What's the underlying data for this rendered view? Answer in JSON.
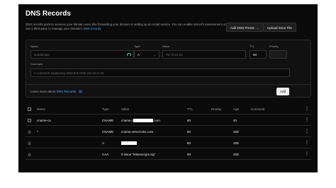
{
  "header": {
    "title": "DNS Records",
    "description_text": "DNS records point to services your domain uses, like forwarding your domain or setting up an email service. You can enable Vercel's nameservers or use a third-party to manage your domain's ",
    "description_link": "DNS records",
    "description_end": "."
  },
  "toolbar": {
    "add_preset_label": "Add DNS Preset",
    "upload_zone_label": "Upload Zone File"
  },
  "form": {
    "name_label": "Name",
    "name_placeholder": "subdomain",
    "type_label": "Type",
    "type_value": "A",
    "value_label": "Value",
    "value_placeholder": "76.76.21.21",
    "ttl_label": "TTL",
    "ttl_value": "60",
    "priority_label": "Priority",
    "priority_value": "",
    "comment_label": "Comment",
    "comment_placeholder": "A comment explaining what this DNS record is for",
    "learn_text": "Learn more about ",
    "learn_link": "DNS Records",
    "add_label": "Add"
  },
  "table": {
    "columns": [
      "Name",
      "Type",
      "Value",
      "TTL",
      "Priority",
      "Age",
      "Comment"
    ],
    "rows": [
      {
        "name": "cname-ca",
        "type": "CNAME",
        "value_prefix": "cname.c",
        "value_suffix": ".com.",
        "ttl": "60",
        "priority": "",
        "age": "4h",
        "comment": "",
        "locked": false
      },
      {
        "name": "*",
        "type": "CNAME",
        "value_prefix": "cname.vercel-dns.com.",
        "value_suffix": "",
        "ttl": "60",
        "priority": "",
        "age": "20d",
        "comment": "",
        "locked": true
      },
      {
        "name": "",
        "type": "A",
        "value_prefix": "",
        "value_suffix": "",
        "ttl": "60",
        "priority": "",
        "age": "20d",
        "comment": "",
        "locked": true
      },
      {
        "name": "",
        "type": "CAA",
        "value_prefix": "0 issue \"letsencrypt.org\"",
        "value_suffix": "",
        "ttl": "60",
        "priority": "",
        "age": "20d",
        "comment": "",
        "locked": true
      }
    ]
  },
  "colors": {
    "background": "#0a0a0a",
    "link": "#52a8ff",
    "accent_icon": "#2ec4b6"
  },
  "icons": {
    "row_menu": "more-vertical-icon",
    "external": "external-link-icon",
    "lock": "lock-icon",
    "field_icon": "loading-arc-icon"
  }
}
